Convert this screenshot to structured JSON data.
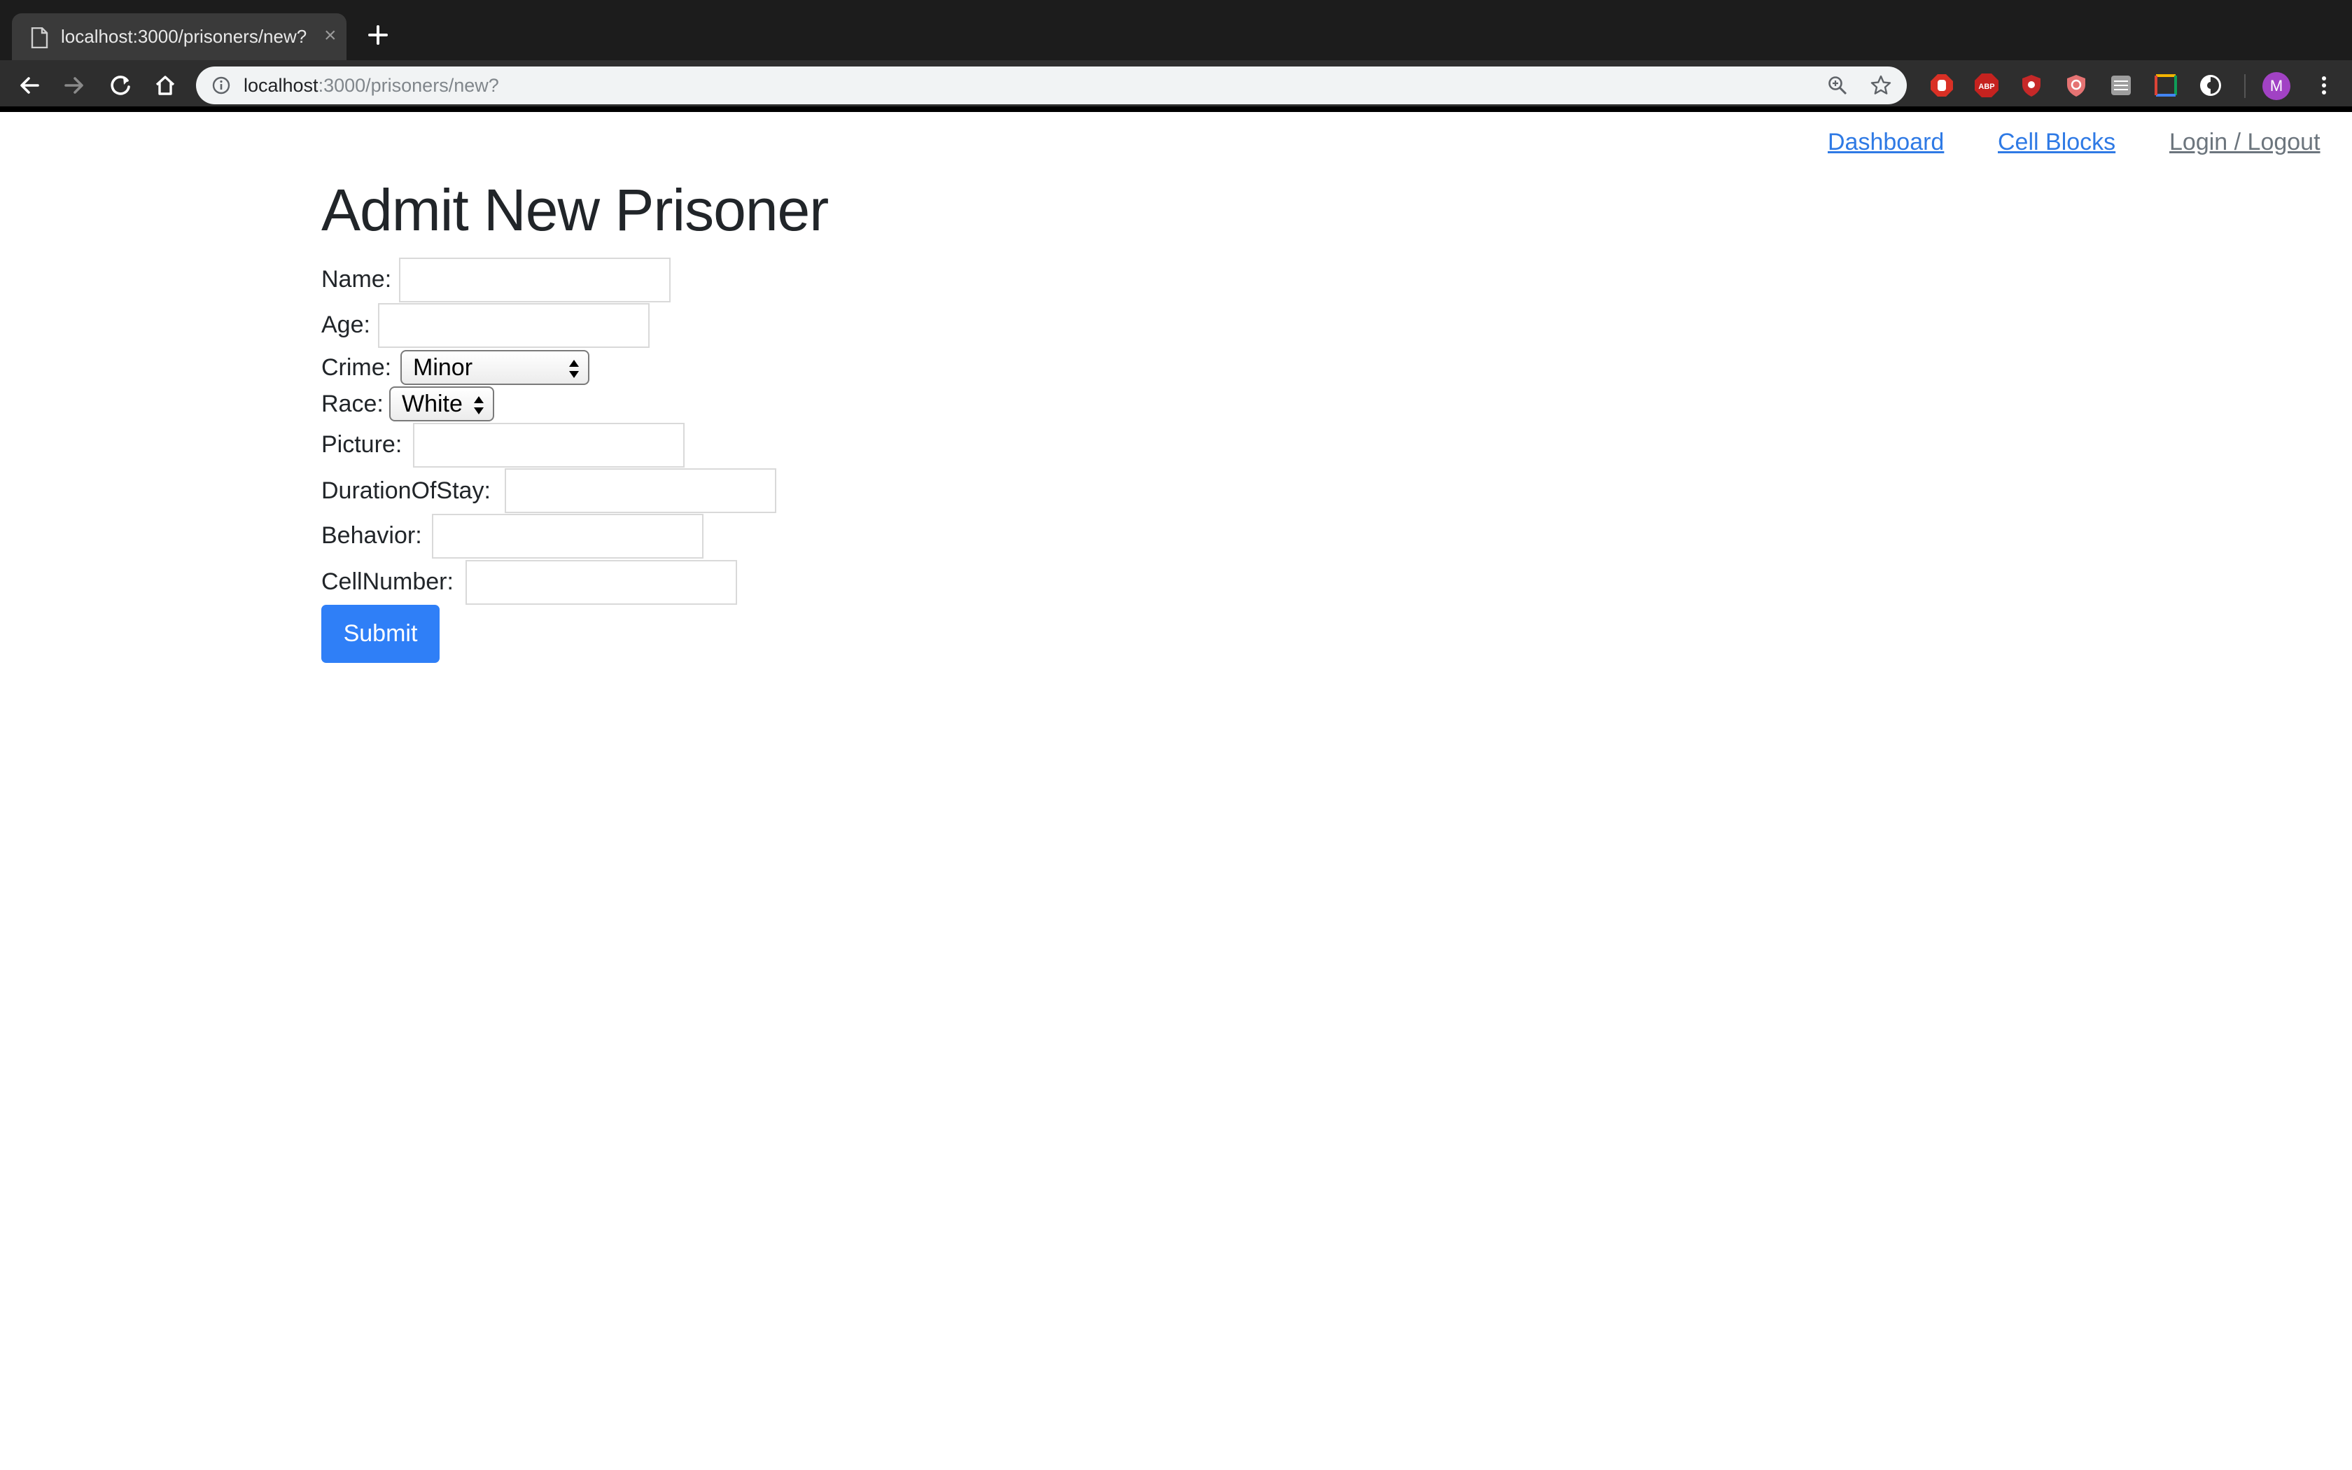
{
  "browser": {
    "tab_title": "localhost:3000/prisoners/new?",
    "tab_close": "×",
    "url_host": "localhost",
    "url_rest": ":3000/prisoners/new?",
    "avatar_letter": "M"
  },
  "nav": {
    "dashboard": "Dashboard",
    "cell_blocks": "Cell Blocks",
    "login_logout": "Login / Logout"
  },
  "page": {
    "title": "Admit New Prisoner"
  },
  "form": {
    "name_label": "Name:",
    "name_value": "",
    "age_label": "Age:",
    "age_value": "",
    "crime_label": "Crime:",
    "crime_value": "Minor",
    "race_label": "Race:",
    "race_value": "White",
    "picture_label": "Picture:",
    "picture_value": "",
    "duration_label": "DurationOfStay:",
    "duration_value": "",
    "behavior_label": "Behavior:",
    "behavior_value": "",
    "cellnumber_label": "CellNumber:",
    "cellnumber_value": "",
    "submit_label": "Submit"
  },
  "colors": {
    "link": "#2f7ae5",
    "muted_link": "#6c757d",
    "primary_button": "#2f7ff7"
  }
}
